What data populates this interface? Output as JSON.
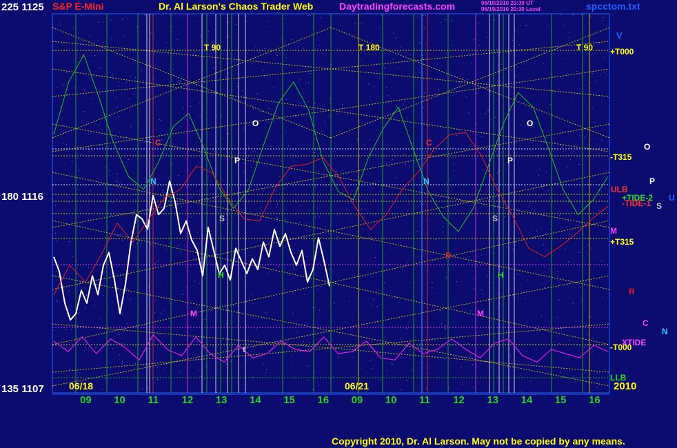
{
  "header": {
    "symbol": "S&P E-Mini",
    "title": "Dr. Al Larson's Chaos Trader Web",
    "site": "Daytradingforecasts.com",
    "stamp1": "06/19/2010 20:30 UT",
    "stamp2": "06/19/2010 20:30 Local",
    "file": "spcctom.txt"
  },
  "y_labels": {
    "top": "225  1125",
    "mid": "180  1116",
    "bottom": "135  1107"
  },
  "dates": {
    "first": "06/18",
    "second": "06/21",
    "year": "2010"
  },
  "x_ticks": [
    "09",
    "10",
    "11",
    "12",
    "13",
    "14",
    "15",
    "16",
    "09",
    "10",
    "11",
    "12",
    "13",
    "14",
    "15",
    "16"
  ],
  "right_labels": {
    "v": "V",
    "t000p": "+T000",
    "t315m": "-T315",
    "o": "O",
    "p": "P",
    "ulb": "ULB",
    "tide2": "+TIDE-2",
    "tide1": "-TIDE-1",
    "s": "S",
    "u": "U",
    "m": "M",
    "t315p": "+T315",
    "r": "R",
    "c": "C",
    "n": "N",
    "xtide": "XTIDE",
    "t000m": "-T000",
    "llb": "LLB"
  },
  "markers": {
    "t90a": "T   90",
    "t180": "T   180",
    "t90b": "T   90",
    "c": "C",
    "n": "N",
    "o": "O",
    "p": "P",
    "s": "S",
    "h": "H",
    "m": "M",
    "t": "t",
    "r": "R"
  },
  "copyright": "Copyright 2010, Dr. Al Larson. May not be copied by any means.",
  "colors": {
    "background": "#0b0b70",
    "grid_yellow": "#e6e600",
    "red_line": "#e02020",
    "green_line": "#20c020",
    "magenta_line": "#e020e0"
  },
  "chart_data": {
    "type": "line",
    "title": "S&P E-Mini",
    "ylim": [
      1107,
      1125
    ],
    "y_ticks": [
      1107,
      1116,
      1125
    ],
    "x_ticks": [
      "09",
      "10",
      "11",
      "12",
      "13",
      "14",
      "15",
      "16",
      "09",
      "10",
      "11",
      "12",
      "13",
      "14",
      "15",
      "16"
    ],
    "series": [
      {
        "name": "price",
        "values": [
          1113.2,
          1112.5,
          1111.0,
          1110.2,
          1110.5,
          1111.6,
          1111.0,
          1112.3,
          1111.4,
          1112.8,
          1113.4,
          1112.1,
          1110.5,
          1111.9,
          1113.9,
          1115.2,
          1115.0,
          1114.5,
          1116.1,
          1115.2,
          1115.5,
          1116.8,
          1115.8,
          1114.3,
          1114.9,
          1114.0,
          1113.5,
          1112.3,
          1114.6,
          1113.5,
          1112.4,
          1112.8,
          1112.1,
          1113.6,
          1113.0,
          1112.4,
          1113.1,
          1112.6,
          1113.9,
          1113.2,
          1114.5,
          1113.7,
          1114.3,
          1113.4,
          1112.8,
          1113.5,
          1112.0,
          1112.6,
          1114.1,
          1113.0,
          1111.8
        ]
      },
      {
        "values": [
          1119.0,
          1121.5,
          1122.8,
          1120.8,
          1118.6,
          1117.0,
          1116.4,
          1117.7,
          1119.4,
          1120.0,
          1118.4,
          1116.5,
          1115.5,
          1116.4,
          1118.5,
          1120.5,
          1121.5,
          1120.2,
          1117.7,
          1116.3,
          1115.9,
          1117.9,
          1119.3,
          1120.3,
          1118.3,
          1116.3,
          1115.1,
          1114.4,
          1115.5,
          1117.5,
          1119.5,
          1121.0,
          1120.3,
          1118.4,
          1116.4,
          1115.2,
          1115.9,
          1117.0
        ]
      },
      {
        "values": [
          1111.4,
          1112.8,
          1112.0,
          1113.3,
          1114.8,
          1113.9,
          1115.0,
          1116.0,
          1116.4,
          1117.5,
          1117.2,
          1116.0,
          1115.0,
          1114.9,
          1116.5,
          1117.5,
          1117.6,
          1117.9,
          1117.0,
          1115.6,
          1114.5,
          1115.2,
          1116.4,
          1117.2,
          1118.3,
          1119.0,
          1119.1,
          1118.0,
          1116.4,
          1115.1,
          1113.6,
          1113.2,
          1113.7,
          1114.3,
          1115.0,
          1115.6
        ]
      },
      {
        "values": [
          1109.2,
          1108.7,
          1109.4,
          1108.6,
          1109.3,
          1108.9,
          1108.3,
          1109.5,
          1108.8,
          1108.5,
          1109.4,
          1108.6,
          1108.2,
          1109.0,
          1108.4,
          1108.6,
          1109.2,
          1108.8,
          1108.7,
          1109.4,
          1108.6,
          1108.7,
          1109.2,
          1108.4,
          1108.3,
          1109.1,
          1108.6,
          1108.8,
          1109.3,
          1108.8,
          1108.4,
          1109.1,
          1109.3,
          1108.5,
          1108.2,
          1108.8,
          1108.6,
          1108.4,
          1109.0,
          1108.7
        ]
      }
    ]
  }
}
